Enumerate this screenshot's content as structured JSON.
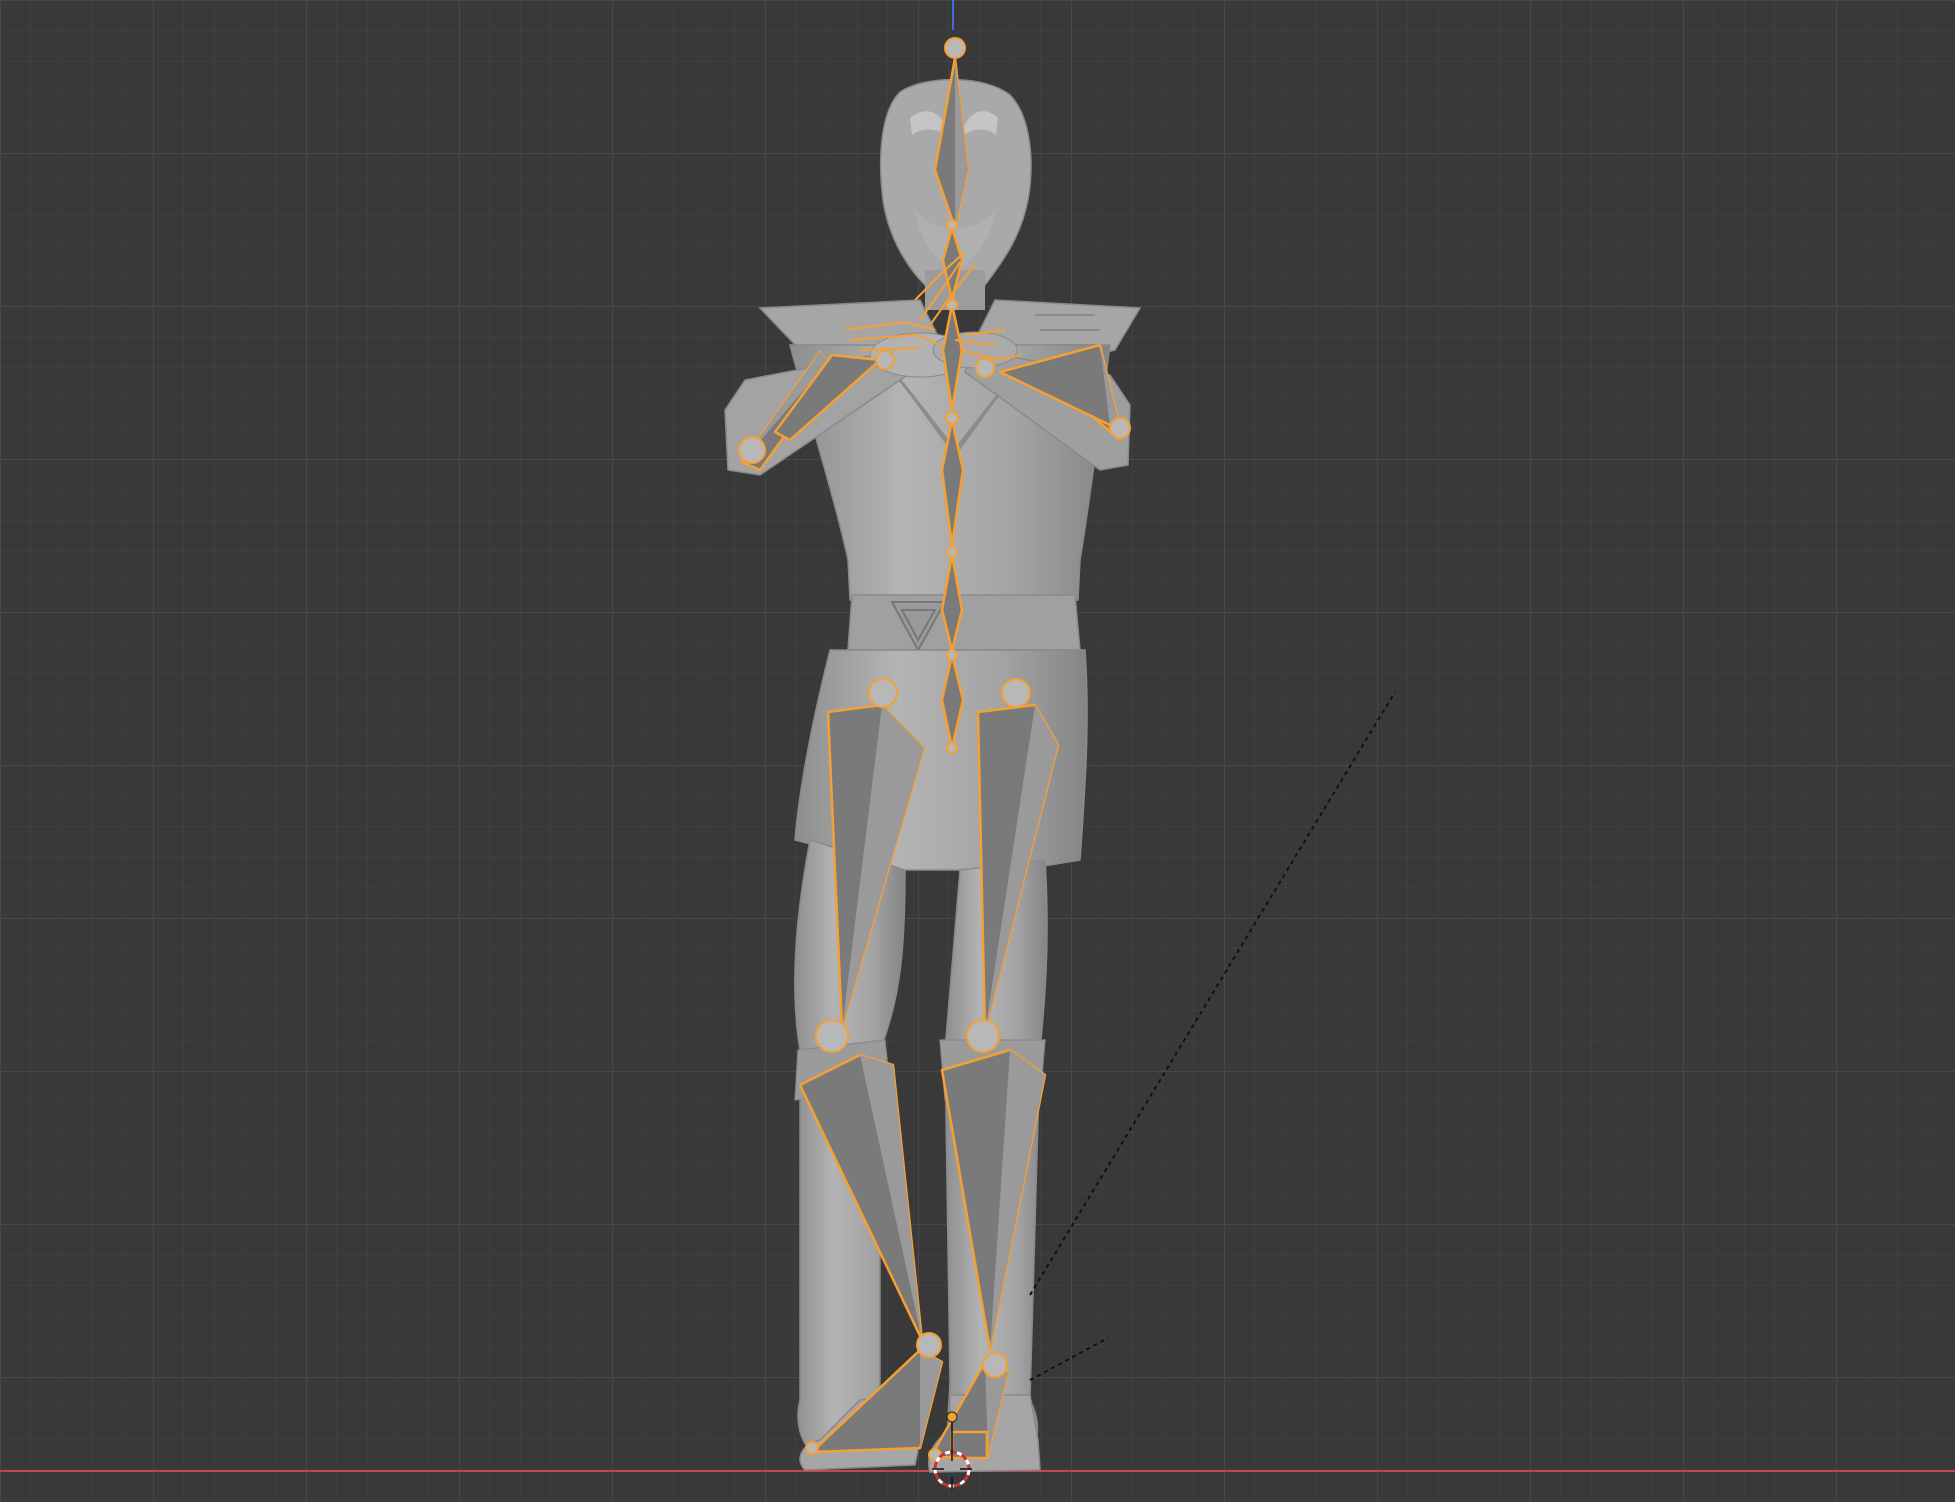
{
  "viewport": {
    "name": "3D Viewport",
    "view": "front-orthographic",
    "mode": "pose",
    "colors": {
      "background": "#393939",
      "grid_minor": "#454545",
      "grid_major": "#4d4d4d",
      "x_axis": "#c8444e",
      "z_axis": "#3b6fd1",
      "bone_outline": "#f5a033",
      "mesh": "#a9a9a9"
    }
  },
  "scene": {
    "character": "character-mesh",
    "armature": "armature-bones",
    "cursor": "3d-cursor-icon",
    "origin": "object-origin-icon"
  }
}
